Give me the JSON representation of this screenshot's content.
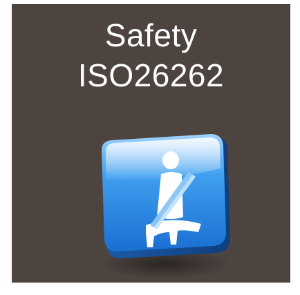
{
  "tile": {
    "title_line1": "Safety",
    "title_line2": "ISO26262",
    "background_color": "#4d4440",
    "icon": "seatbelt-icon",
    "icon_color": "#2f8fe0"
  }
}
